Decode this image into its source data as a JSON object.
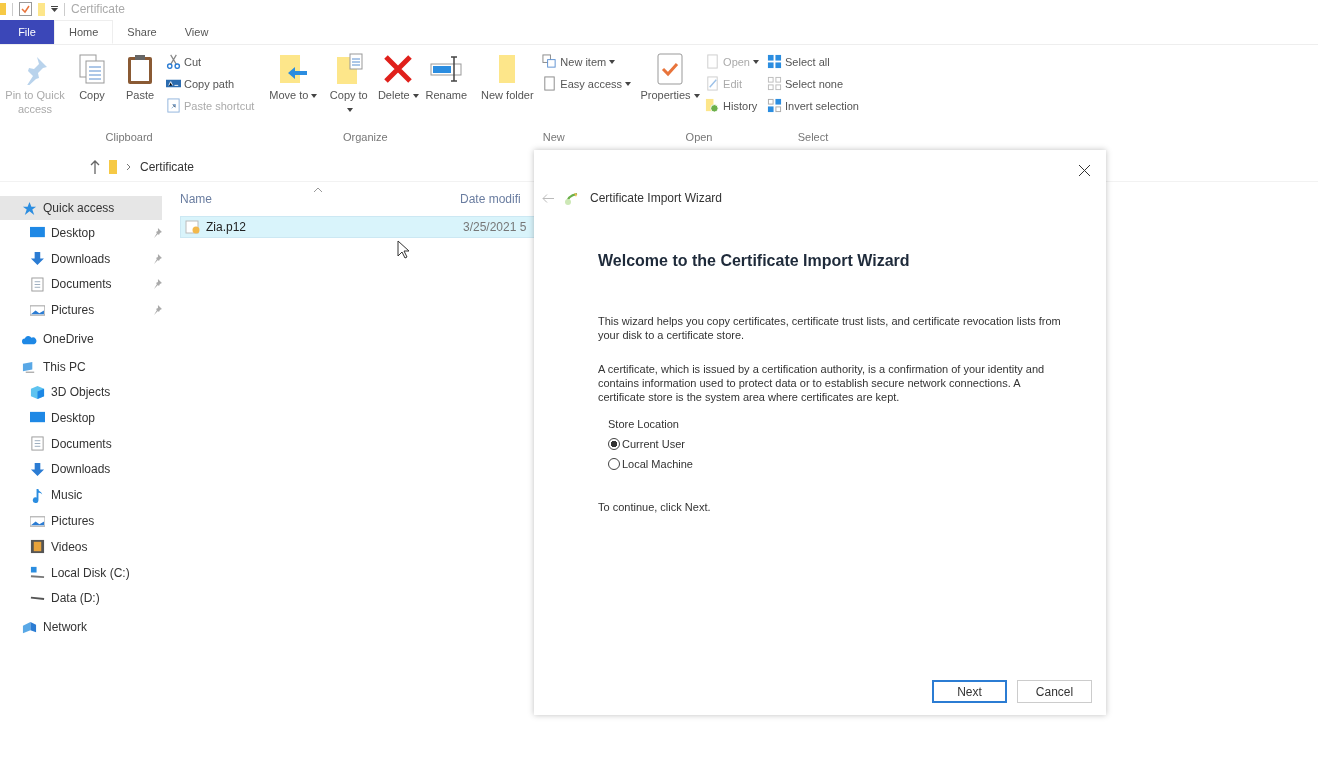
{
  "window": {
    "title": "Certificate"
  },
  "ribbon_tabs": [
    {
      "label": "File",
      "kind": "file",
      "selected": false
    },
    {
      "label": "Home",
      "kind": "tab",
      "selected": true
    },
    {
      "label": "Share",
      "kind": "tab",
      "selected": false
    },
    {
      "label": "View",
      "kind": "tab",
      "selected": false
    }
  ],
  "ribbon_groups": [
    {
      "label": "Clipboard",
      "items": [
        {
          "kind": "large",
          "label": "Pin to Quick access",
          "disabled": true
        },
        {
          "kind": "large",
          "label": "Copy",
          "disabled": false
        },
        {
          "kind": "large",
          "label": "Paste",
          "disabled": false
        },
        {
          "kind": "stack",
          "items": [
            {
              "label": "Cut",
              "disabled": false,
              "dropdown": false
            },
            {
              "label": "Copy path",
              "disabled": false,
              "dropdown": false
            },
            {
              "label": "Paste shortcut",
              "disabled": true,
              "dropdown": false
            }
          ]
        }
      ]
    },
    {
      "label": "Organize",
      "items": [
        {
          "kind": "large",
          "label": "Move to",
          "disabled": false,
          "dropdown": true
        },
        {
          "kind": "large",
          "label": "Copy to",
          "disabled": false,
          "dropdown": true
        },
        {
          "kind": "large",
          "label": "Delete",
          "disabled": false,
          "dropdown": true
        },
        {
          "kind": "large",
          "label": "Rename",
          "disabled": false
        }
      ]
    },
    {
      "label": "New",
      "items": [
        {
          "kind": "large",
          "label": "New folder",
          "disabled": false
        },
        {
          "kind": "stack",
          "items": [
            {
              "label": "New item",
              "disabled": false,
              "dropdown": true
            },
            {
              "label": "Easy access",
              "disabled": false,
              "dropdown": true
            }
          ]
        }
      ]
    },
    {
      "label": "Open",
      "items": [
        {
          "kind": "large",
          "label": "Properties",
          "disabled": false,
          "dropdown": true
        },
        {
          "kind": "stack",
          "items": [
            {
              "label": "Open",
              "disabled": true,
              "dropdown": true
            },
            {
              "label": "Edit",
              "disabled": true,
              "dropdown": false
            },
            {
              "label": "History",
              "disabled": false,
              "dropdown": false
            }
          ]
        }
      ]
    },
    {
      "label": "Select",
      "items": [
        {
          "kind": "stack",
          "items": [
            {
              "label": "Select all",
              "disabled": false,
              "dropdown": false
            },
            {
              "label": "Select none",
              "disabled": false,
              "dropdown": false
            },
            {
              "label": "Invert selection",
              "disabled": false,
              "dropdown": false
            }
          ]
        }
      ]
    }
  ],
  "address_bar": {
    "path": [
      "Certificate"
    ]
  },
  "sidebar": {
    "items": [
      {
        "label": "Quick access",
        "selected": true,
        "children": [
          {
            "label": "Desktop",
            "pinned": true,
            "selected": false
          },
          {
            "label": "Downloads",
            "pinned": true,
            "selected": false
          },
          {
            "label": "Documents",
            "pinned": true,
            "selected": false
          },
          {
            "label": "Pictures",
            "pinned": true,
            "selected": false
          }
        ]
      },
      {
        "label": "OneDrive",
        "selected": false
      },
      {
        "label": "This PC",
        "selected": false,
        "children": [
          {
            "label": "3D Objects",
            "pinned": false,
            "selected": false
          },
          {
            "label": "Desktop",
            "pinned": false,
            "selected": false
          },
          {
            "label": "Documents",
            "pinned": false,
            "selected": false
          },
          {
            "label": "Downloads",
            "pinned": false,
            "selected": false
          },
          {
            "label": "Music",
            "pinned": false,
            "selected": false
          },
          {
            "label": "Pictures",
            "pinned": false,
            "selected": false
          },
          {
            "label": "Videos",
            "pinned": false,
            "selected": false
          },
          {
            "label": "Local Disk (C:)",
            "pinned": false,
            "selected": false
          },
          {
            "label": "Data (D:)",
            "pinned": false,
            "selected": false
          }
        ]
      },
      {
        "label": "Network",
        "selected": false
      }
    ]
  },
  "file_list": {
    "columns": [
      "Name",
      "Date modifi"
    ],
    "rows": [
      {
        "name": "Zia.p12",
        "date": "3/25/2021 5",
        "selected": true
      }
    ]
  },
  "dialog": {
    "title": "Certificate Import Wizard",
    "heading": "Welcome to the Certificate Import Wizard",
    "paragraphs": [
      "This wizard helps you copy certificates, certificate trust lists, and certificate revocation lists from your disk to a certificate store.",
      "A certificate, which is issued by a certification authority, is a confirmation of your identity and contains information used to protect data or to establish secure network connections. A certificate store is the system area where certificates are kept."
    ],
    "store_location": {
      "label": "Store Location",
      "options": [
        {
          "label": "Current User",
          "selected": true
        },
        {
          "label": "Local Machine",
          "selected": false
        }
      ]
    },
    "hint": "To continue, click Next.",
    "buttons": [
      {
        "label": "Next",
        "default": true
      },
      {
        "label": "Cancel",
        "default": false
      }
    ]
  }
}
